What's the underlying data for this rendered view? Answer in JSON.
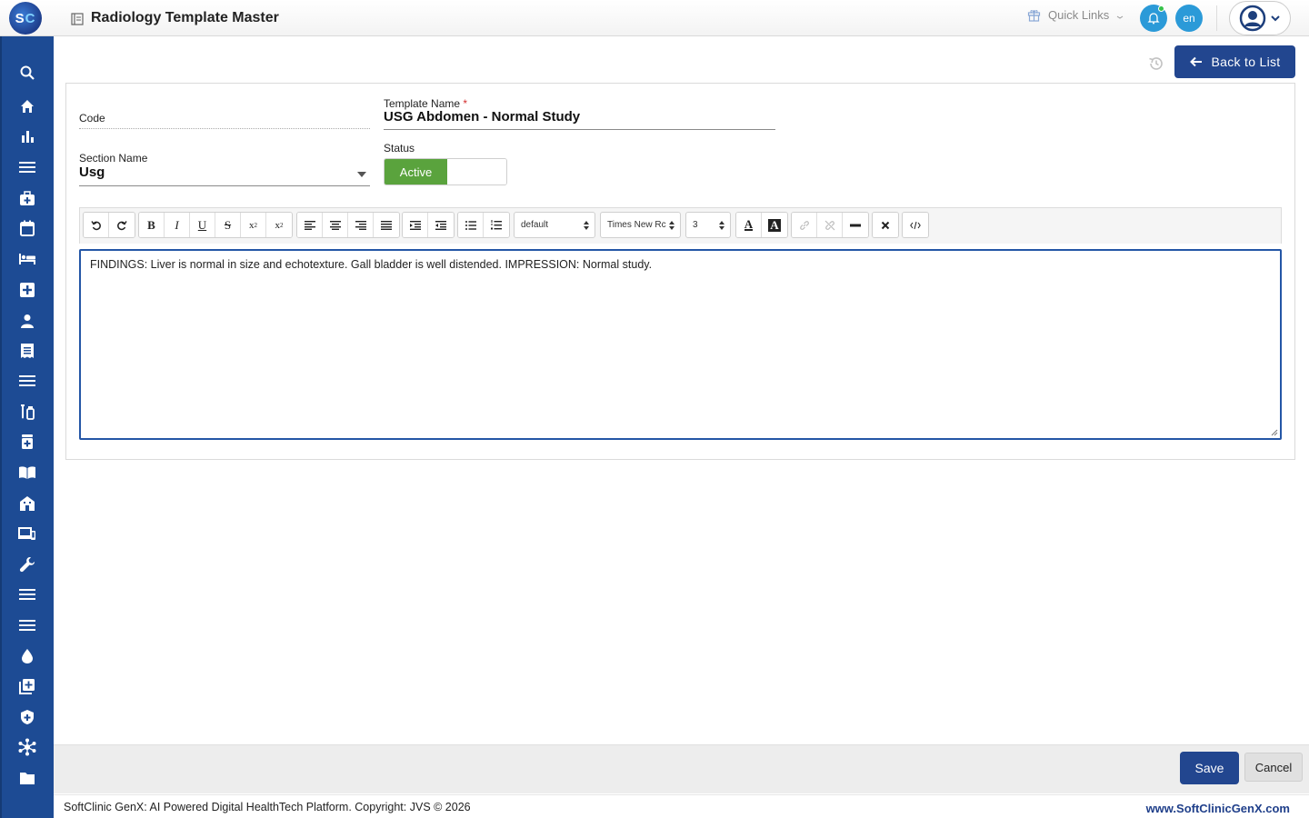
{
  "header": {
    "logo_text_s": "S",
    "logo_text_c": "C",
    "title": "Radiology Template Master",
    "quick_links": "Quick Links",
    "lang": "en"
  },
  "sidebar": {
    "items": [
      "search-icon",
      "home-icon",
      "chart-icon",
      "menu-icon",
      "medical-kit-icon",
      "calendar-icon",
      "bed-icon",
      "hospital-plus-icon",
      "person-icon",
      "receipt-icon",
      "menu-icon",
      "lab-tubes-icon",
      "pharmacy-icon",
      "book-icon",
      "building-icon",
      "devices-icon",
      "wrench-icon",
      "menu-icon",
      "menu-icon",
      "blood-drop-icon",
      "add-library-icon",
      "shield-icon",
      "network-icon",
      "folder-icon"
    ]
  },
  "actions": {
    "back_label": "Back to List",
    "save_label": "Save",
    "cancel_label": "Cancel"
  },
  "form": {
    "code_label": "Code",
    "code_value": "",
    "template_name_label": "Template Name",
    "required_mark": "*",
    "template_name_value": "USG Abdomen - Normal Study",
    "section_name_label": "Section Name",
    "section_name_value": "Usg",
    "status_label": "Status",
    "status_value": "Active"
  },
  "editor": {
    "toolbar": {
      "format_block": "default",
      "font_name": "Times New Rc",
      "font_size": "3"
    },
    "content": "FINDINGS: Liver is normal in size and echotexture. Gall bladder is well distended. IMPRESSION: Normal study."
  },
  "footer": {
    "copyright": "SoftClinic GenX: AI Powered Digital HealthTech Platform. Copyright: JVS © 2026",
    "website": "www.SoftClinicGenX.com"
  },
  "colors": {
    "primary": "#22468f",
    "sidebar": "#1d4b94",
    "status_active": "#5aa33d",
    "editor_border": "#2456a6"
  }
}
